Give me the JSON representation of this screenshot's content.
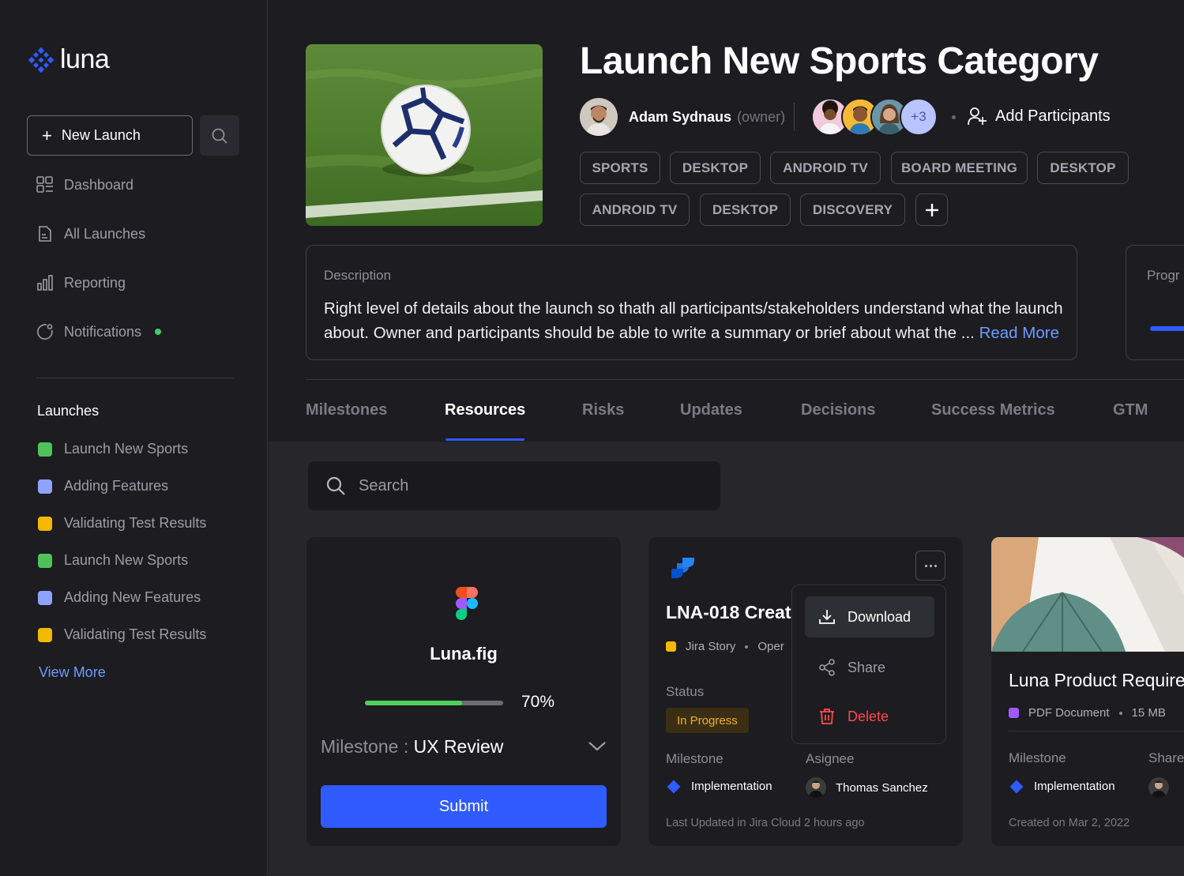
{
  "app": {
    "name": "luna"
  },
  "sidebar": {
    "new_launch_label": "New Launch",
    "nav": [
      {
        "label": "Dashboard",
        "icon": "grid-icon"
      },
      {
        "label": "All Launches",
        "icon": "document-icon"
      },
      {
        "label": "Reporting",
        "icon": "bar-chart-icon"
      },
      {
        "label": "Notifications",
        "icon": "notification-icon",
        "has_dot": true
      }
    ],
    "launches_heading": "Launches",
    "launches": [
      {
        "label": "Launch New Sports",
        "color": "#4fc35a"
      },
      {
        "label": "Adding  Features",
        "color": "#8ea2ff"
      },
      {
        "label": "Validating Test Results",
        "color": "#f5b800"
      },
      {
        "label": "Launch New Sports",
        "color": "#4fc35a"
      },
      {
        "label": "Adding New Features",
        "color": "#8ea2ff"
      },
      {
        "label": "Validating Test Results",
        "color": "#f5b800"
      }
    ],
    "view_more": "View More"
  },
  "header": {
    "title": "Launch New Sports Category",
    "owner_name": "Adam Sydnaus",
    "owner_role": "(owner)",
    "participants_extra": "+3",
    "add_participants": "Add Participants",
    "tags": [
      "SPORTS",
      "DESKTOP",
      "ANDROID TV",
      "BOARD MEETING",
      "DESKTOP",
      "ANDROID TV",
      "DESKTOP",
      "DISCOVERY"
    ]
  },
  "description": {
    "label": "Description",
    "text": "Right level of details about the launch so thath all participants/stakeholders understand what the launch about. Owner and participants should be able to write a summary or brief about what the ... ",
    "read_more": "Read More"
  },
  "progress_card": {
    "label": "Progr"
  },
  "tabs": [
    {
      "label": "Milestones",
      "active": false
    },
    {
      "label": "Resources",
      "active": true
    },
    {
      "label": "Risks",
      "active": false
    },
    {
      "label": "Updates",
      "active": false
    },
    {
      "label": "Decisions",
      "active": false
    },
    {
      "label": "Success Metrics",
      "active": false
    },
    {
      "label": "GTM",
      "active": false
    }
  ],
  "search": {
    "placeholder": "Search"
  },
  "cards": {
    "figma": {
      "file_name": "Luna.fig",
      "progress": 0.7,
      "progress_label": "70%",
      "milestone_label": "Milestone : ",
      "milestone_value": "UX Review",
      "submit_label": "Submit"
    },
    "jira": {
      "title": "LNA-018 Creat",
      "type": "Jira Story",
      "state": "Oper",
      "status_label": "Status",
      "status_value": "In Progress",
      "milestone_label": "Milestone",
      "milestone_value": "Implementation",
      "assignee_label": "Asignee",
      "assignee_name": "Thomas Sanchez",
      "footer": "Last Updated in Jira Cloud 2 hours ago"
    },
    "doc": {
      "title": "Luna Product Require",
      "type": "PDF Document",
      "size": "15 MB",
      "milestone_label": "Milestone",
      "milestone_value": "Implementation",
      "shared_label": "Share",
      "footer": "Created on Mar 2, 2022"
    }
  },
  "context_menu": {
    "download": "Download",
    "share": "Share",
    "delete": "Delete"
  },
  "colors": {
    "accent": "#2f5bff",
    "link": "#6f9cff",
    "success": "#4fd05a",
    "danger": "#ff4b4b",
    "warning": "#f2b21a"
  }
}
